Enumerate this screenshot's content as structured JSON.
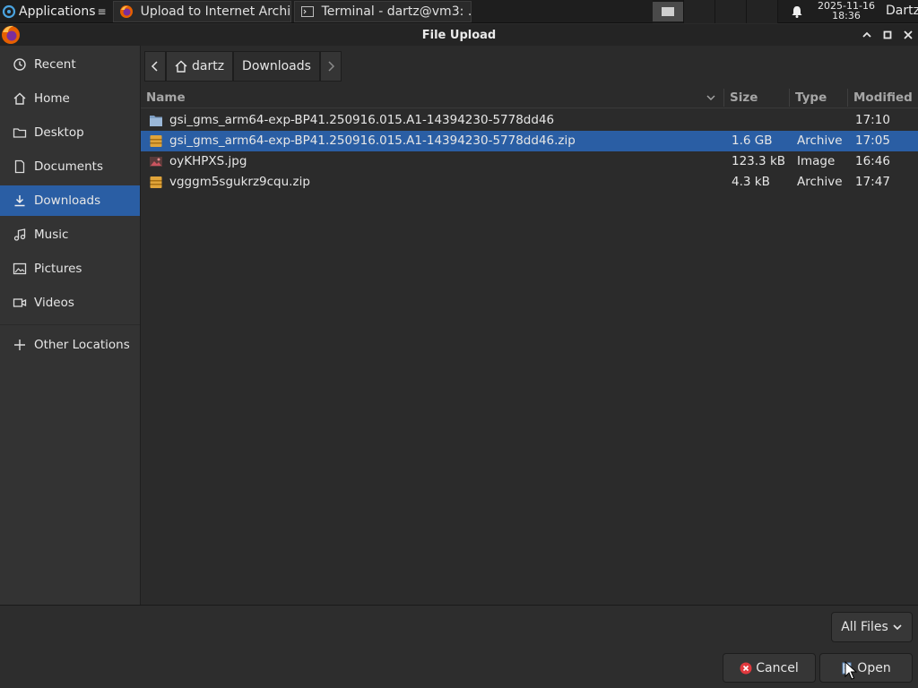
{
  "taskbar": {
    "apps_label": "Applications",
    "tasks": [
      {
        "label": "Upload to Internet Archi…",
        "icon": "firefox-icon"
      },
      {
        "label": "Terminal - dartz@vm3: …",
        "icon": "terminal-icon"
      }
    ],
    "clock_date": "2025-11-16",
    "clock_time": "18:36",
    "user": "Dartz"
  },
  "window": {
    "title": "File Upload"
  },
  "sidebar": {
    "items": [
      {
        "label": "Recent",
        "icon": "recent-icon"
      },
      {
        "label": "Home",
        "icon": "home-icon"
      },
      {
        "label": "Desktop",
        "icon": "folder-icon"
      },
      {
        "label": "Documents",
        "icon": "document-icon"
      },
      {
        "label": "Downloads",
        "icon": "download-icon",
        "active": true
      },
      {
        "label": "Music",
        "icon": "music-icon"
      },
      {
        "label": "Pictures",
        "icon": "picture-icon"
      },
      {
        "label": "Videos",
        "icon": "video-icon"
      },
      {
        "label": "Other Locations",
        "icon": "plus-icon"
      }
    ]
  },
  "pathbar": {
    "home_label": "dartz",
    "current_label": "Downloads"
  },
  "columns": {
    "name": "Name",
    "size": "Size",
    "type": "Type",
    "modified": "Modified"
  },
  "files": [
    {
      "name": "gsi_gms_arm64-exp-BP41.250916.015.A1-14394230-5778dd46",
      "size": "",
      "type": "",
      "modified": "17:10",
      "icon": "folder-icon"
    },
    {
      "name": "gsi_gms_arm64-exp-BP41.250916.015.A1-14394230-5778dd46.zip",
      "size": "1.6 GB",
      "type": "Archive",
      "modified": "17:05",
      "icon": "archive-icon",
      "selected": true
    },
    {
      "name": "oyKHPXS.jpg",
      "size": "123.3 kB",
      "type": "Image",
      "modified": "16:46",
      "icon": "image-icon"
    },
    {
      "name": "vgggm5sgukrz9cqu.zip",
      "size": "4.3 kB",
      "type": "Archive",
      "modified": "17:47",
      "icon": "archive-icon"
    }
  ],
  "footer": {
    "filter_label": "All Files",
    "cancel_label": "Cancel",
    "open_label": "Open"
  },
  "colors": {
    "selection": "#2a5ea4",
    "background": "#2b2b2b",
    "sidebar": "#333333"
  }
}
